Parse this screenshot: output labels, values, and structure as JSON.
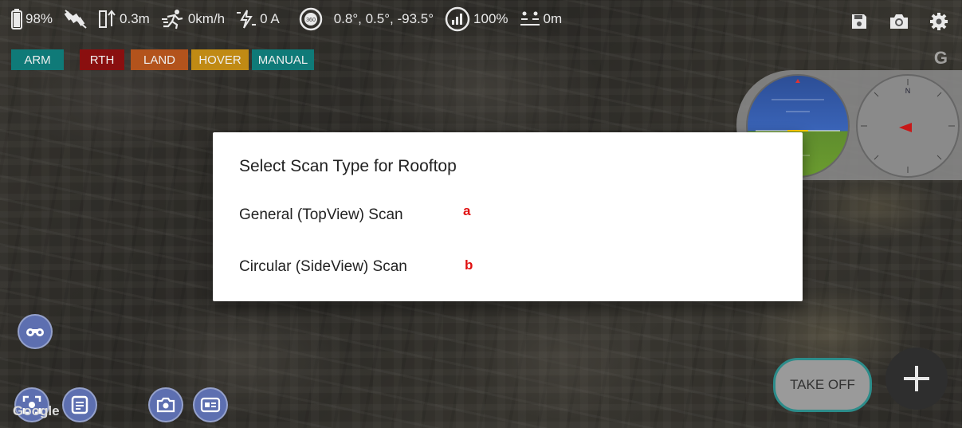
{
  "status": {
    "battery": "98%",
    "altitude": "0.3m",
    "speed": "0km/h",
    "current": "0 A",
    "orientation_badge": "360",
    "orientation": "0.8°,  0.5°, -93.5°",
    "signal": "100%",
    "distance": "0m"
  },
  "modes": {
    "arm": "ARM",
    "rth": "RTH",
    "land": "LAND",
    "hover": "HOVER",
    "manual": "MANUAL"
  },
  "map": {
    "brand": "G",
    "attribution": "Google"
  },
  "dialog": {
    "title": "Select Scan Type for Rooftop",
    "options": [
      {
        "label": "General (TopView) Scan",
        "marker": "a"
      },
      {
        "label": "Circular (SideView) Scan",
        "marker": "b"
      }
    ]
  },
  "compass": {
    "north": "N"
  },
  "actions": {
    "takeoff": "TAKE OFF"
  },
  "colors": {
    "arm": "#0f7a78",
    "rth": "#8a0f0f",
    "land": "#b3531c",
    "hover": "#c08a14",
    "manual": "#0f7a78",
    "marker": "#e01010",
    "fab": "#5d6fb0"
  },
  "icons": [
    "battery-icon",
    "no-gps-satellite-icon",
    "altitude-icon",
    "runner-speed-icon",
    "current-bolt-icon",
    "orientation-360-icon",
    "signal-icon",
    "distance-icon",
    "save-icon",
    "camera-icon",
    "settings-gear-icon",
    "binoculars-icon",
    "focus-target-icon",
    "list-icon",
    "camera-icon",
    "card-icon",
    "plus-icon"
  ]
}
